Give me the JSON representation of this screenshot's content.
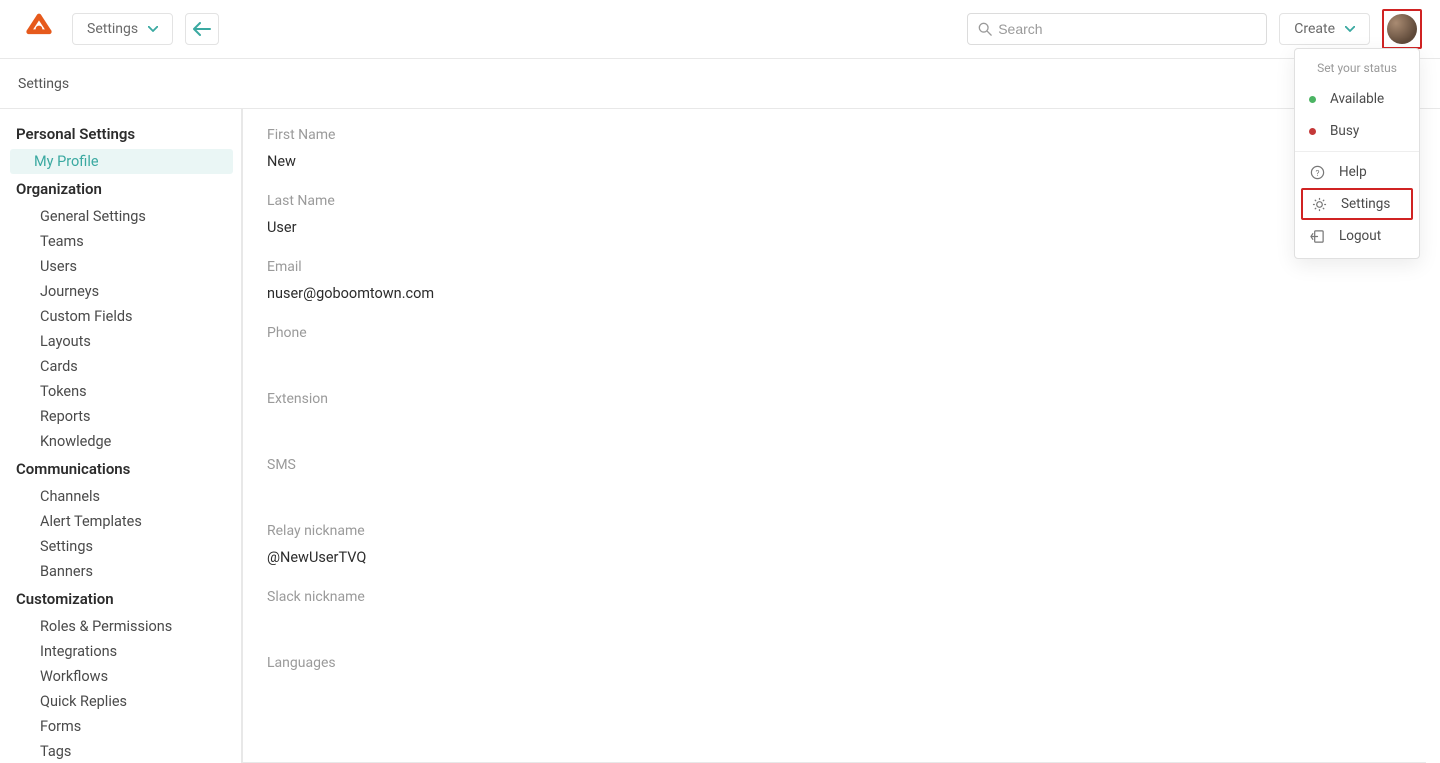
{
  "topbar": {
    "settings_label": "Settings",
    "search_placeholder": "Search",
    "create_label": "Create"
  },
  "breadcrumb": "Settings",
  "sidebar": {
    "sections": [
      {
        "title": "Personal Settings",
        "items": [
          {
            "label": "My Profile",
            "active": true
          }
        ]
      },
      {
        "title": "Organization",
        "items": [
          {
            "label": "General Settings"
          },
          {
            "label": "Teams"
          },
          {
            "label": "Users"
          },
          {
            "label": "Journeys"
          },
          {
            "label": "Custom Fields"
          },
          {
            "label": "Layouts"
          },
          {
            "label": "Cards"
          },
          {
            "label": "Tokens"
          },
          {
            "label": "Reports"
          },
          {
            "label": "Knowledge"
          }
        ]
      },
      {
        "title": "Communications",
        "items": [
          {
            "label": "Channels"
          },
          {
            "label": "Alert Templates"
          },
          {
            "label": "Settings"
          },
          {
            "label": "Banners"
          }
        ]
      },
      {
        "title": "Customization",
        "items": [
          {
            "label": "Roles & Permissions"
          },
          {
            "label": "Integrations"
          },
          {
            "label": "Workflows"
          },
          {
            "label": "Quick Replies"
          },
          {
            "label": "Forms"
          },
          {
            "label": "Tags"
          }
        ]
      }
    ]
  },
  "profile": {
    "first_name_label": "First Name",
    "first_name": "New",
    "last_name_label": "Last Name",
    "last_name": "User",
    "email_label": "Email",
    "email": "nuser@goboomtown.com",
    "phone_label": "Phone",
    "phone": "",
    "extension_label": "Extension",
    "extension": "",
    "sms_label": "SMS",
    "sms": "",
    "relay_label": "Relay nickname",
    "relay": "@NewUserTVQ",
    "slack_label": "Slack nickname",
    "slack": "",
    "languages_label": "Languages",
    "languages": ""
  },
  "dropdown": {
    "header": "Set your status",
    "status_available": "Available",
    "status_busy": "Busy",
    "help": "Help",
    "settings": "Settings",
    "logout": "Logout"
  }
}
